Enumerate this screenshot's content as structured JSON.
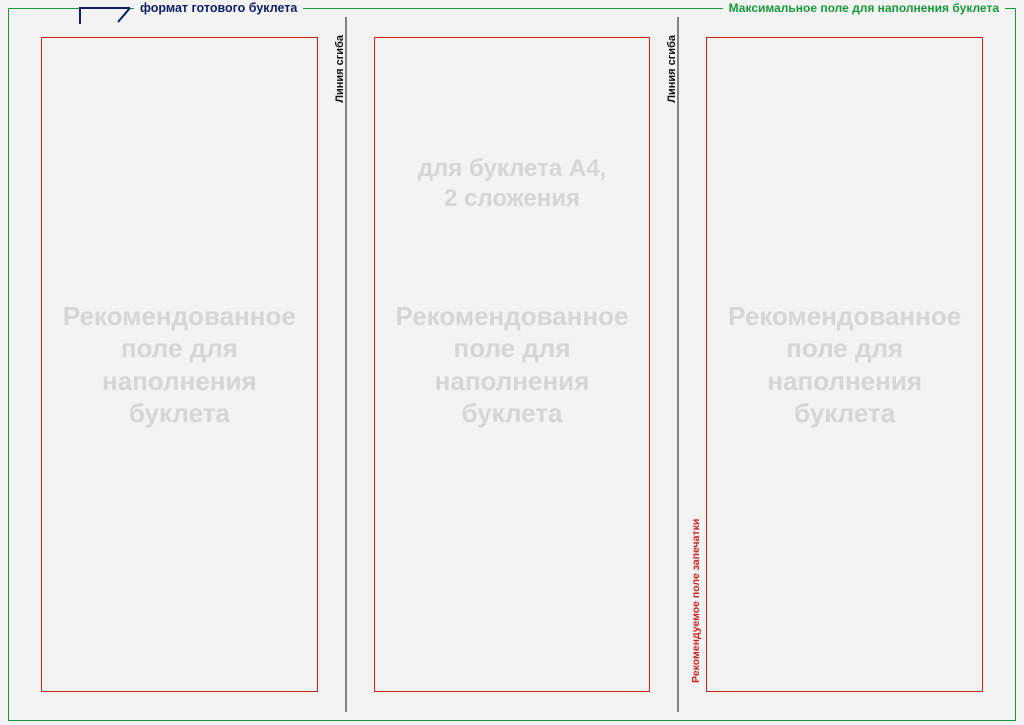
{
  "labels": {
    "format_booklet": "формат готового буклета",
    "max_fill_field": "Максимальное поле для наполнения буклета",
    "fold_line": "Линия сгиба",
    "recommended_print_area": "Рекомендуемое поле запечатки",
    "recommended_fill": "Рекомендованное\nполе для\nнаполнения\nбуклета",
    "booklet_spec": "для буклета A4,\n2 сложения"
  },
  "colors": {
    "green": "#179a3a",
    "navy": "#0b1f6b",
    "red": "#d02020",
    "watermark": "#d5d6d5",
    "bg": "#f2f3f2"
  },
  "layout": {
    "panels": 3,
    "folds": 2
  }
}
